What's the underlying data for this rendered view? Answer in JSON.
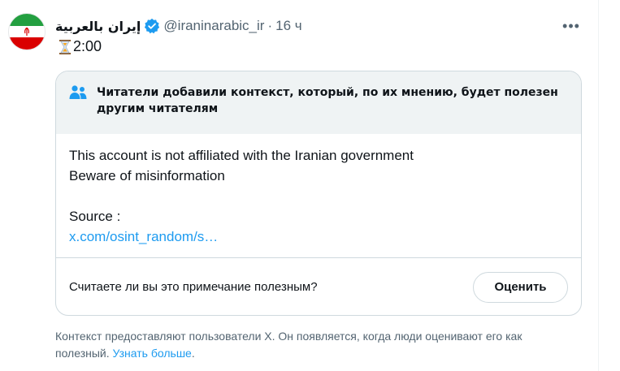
{
  "account": {
    "display_name": "إيران بالعربية",
    "handle": "@iraninarabic_ir",
    "separator": "·",
    "time": "16 ч",
    "more_label": "•••",
    "avatar_colors": {
      "green": "#239f40",
      "white": "#ffffff",
      "red": "#da0000"
    }
  },
  "tweet": {
    "text": "2:00",
    "icon": "hourglass-icon"
  },
  "note": {
    "title": "Читатели добавили контекст, который, по их мнению, будет полезен другим читателям",
    "lines": [
      "This account is not affiliated with the Iranian government",
      "Beware of misinformation"
    ],
    "source_label": "Source :",
    "source_link": "x.com/osint_random/s…",
    "rate_question": "Считаете ли вы это примечание полезным?",
    "rate_button": "Оценить"
  },
  "disclaimer": {
    "text": "Контекст предоставляют пользователи X. Он появляется, когда люди оценивают его как полезный.",
    "learn_more": "Узнать больше",
    "end": "."
  },
  "colors": {
    "link": "#1d9bf0",
    "muted": "#536471",
    "verified": "#1d9bf0"
  }
}
